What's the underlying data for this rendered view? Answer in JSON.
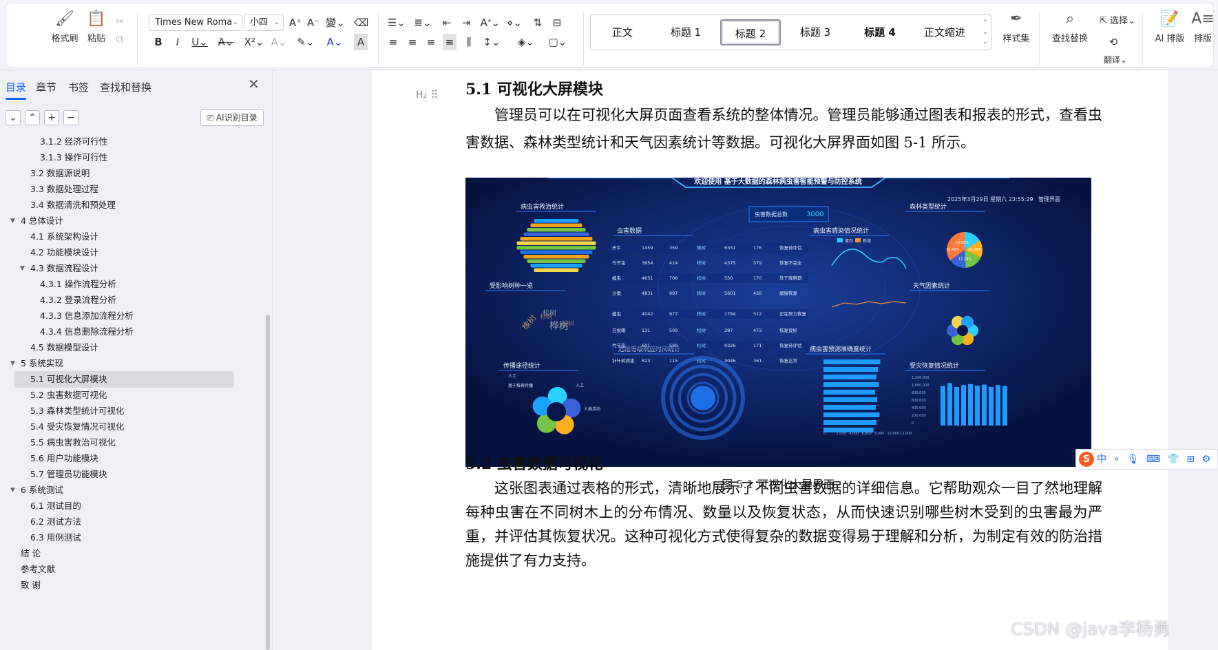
{
  "ribbon": {
    "format_painter": "格式刷",
    "paste": "粘贴",
    "font_family": "Times New Roma",
    "font_size": "小四",
    "styles": [
      {
        "label": "正文",
        "selected": false,
        "bold": false
      },
      {
        "label": "标题 1",
        "selected": false,
        "bold": false
      },
      {
        "label": "标题 2",
        "selected": true,
        "bold": false
      },
      {
        "label": "标题 3",
        "selected": false,
        "bold": false
      },
      {
        "label": "标题 4",
        "selected": false,
        "bold": true
      },
      {
        "label": "正文缩进",
        "selected": false,
        "bold": false
      }
    ],
    "style_set": "样式集",
    "find_replace": "查找替换",
    "select": "选择",
    "translate": "翻译",
    "ai_layout": "AI 排版",
    "layout": "排版"
  },
  "nav": {
    "tabs": [
      "目录",
      "章节",
      "书签",
      "查找和替换"
    ],
    "active_tab": "目录",
    "ai_toc": "AI识别目录",
    "items": [
      {
        "label": "3.1.2  经济可行性",
        "level": 3,
        "toggle": ""
      },
      {
        "label": "3.1.3  操作可行性",
        "level": 3,
        "toggle": ""
      },
      {
        "label": "3.2 数据源说明",
        "level": 2,
        "toggle": ""
      },
      {
        "label": "3.3 数据处理过程",
        "level": 2,
        "toggle": ""
      },
      {
        "label": "3.4 数据清洗和预处理",
        "level": 2,
        "toggle": ""
      },
      {
        "label": "4 总体设计",
        "level": 1,
        "toggle": "▼"
      },
      {
        "label": "4.1 系统架构设计",
        "level": 2,
        "toggle": ""
      },
      {
        "label": "4.2 功能模块设计",
        "level": 2,
        "toggle": ""
      },
      {
        "label": "4.3 数据流程设计",
        "level": 2,
        "toggle": "▼"
      },
      {
        "label": "4.3.1 操作流程分析",
        "level": 3,
        "toggle": ""
      },
      {
        "label": "4.3.2 登录流程分析",
        "level": 3,
        "toggle": ""
      },
      {
        "label": "4.3.3 信息添加流程分析",
        "level": 3,
        "toggle": ""
      },
      {
        "label": "4.3.4 信息删除流程分析",
        "level": 3,
        "toggle": ""
      },
      {
        "label": "4.5  数据模型设计",
        "level": 2,
        "toggle": ""
      },
      {
        "label": "5 系统实现",
        "level": 1,
        "toggle": "▼"
      },
      {
        "label": "5.1  可视化大屏模块",
        "level": 2,
        "toggle": "",
        "selected": true
      },
      {
        "label": "5.2  虫害数据可视化",
        "level": 2,
        "toggle": ""
      },
      {
        "label": "5.3  森林类型统计可视化",
        "level": 2,
        "toggle": ""
      },
      {
        "label": "5.4  受灾恢复情况可视化",
        "level": 2,
        "toggle": ""
      },
      {
        "label": "5.5  病虫害救治可视化",
        "level": 2,
        "toggle": ""
      },
      {
        "label": "5.6  用户功能模块",
        "level": 2,
        "toggle": ""
      },
      {
        "label": "5.7  管理员功能模块",
        "level": 2,
        "toggle": ""
      },
      {
        "label": "6 系统测试",
        "level": 1,
        "toggle": "▼"
      },
      {
        "label": "6.1  测试目的",
        "level": 2,
        "toggle": ""
      },
      {
        "label": "6.2  测试方法",
        "level": 2,
        "toggle": ""
      },
      {
        "label": "6.3  用例测试",
        "level": 2,
        "toggle": ""
      },
      {
        "label": "结    论",
        "level": 1,
        "toggle": ""
      },
      {
        "label": "参考文献",
        "level": 1,
        "toggle": ""
      },
      {
        "label": "致    谢",
        "level": 1,
        "toggle": ""
      }
    ]
  },
  "document": {
    "heading_mark": "H₂",
    "section1_title": "5.1  可视化大屏模块",
    "section1_para": "管理员可以在可视化大屏页面查看系统的整体情况。管理员能够通过图表和报表的形式，查看虫害数据、森林类型统计和天气因素统计等数据。可视化大屏界面如图 5-1 所示。",
    "figure_caption": "图 5.1  可视化大屏界面",
    "section2_title": "5.2  虫害数据可视化",
    "section2_para": "这张图表通过表格的形式，清晰地展示了不同虫害数据的详细信息。它帮助观众一目了然地理解每种虫害在不同树木上的分布情况、数量以及恢复状态，从而快速识别哪些树木受到的虫害最为严重，并评估其恢复状况。这种可视化方式使得复杂的数据变得易于理解和分析，为制定有效的防治措施提供了有力支持。"
  },
  "dashboard": {
    "title": "欢迎使用 基于大数据的森林病虫害智能预警与防控系统",
    "datetime": "2025年3月29日 星期六 23:55:29",
    "admin": "管理界面",
    "pest_total_label": "虫害数据总数",
    "pest_total_value": "3000",
    "panels": {
      "treatment": "病虫害救治统计",
      "pest_data": "虫害数据",
      "infection": "病虫害感染情况统计",
      "forest_type": "森林类型统计",
      "affected_species": "受影响树种一览",
      "weather": "天气因素统计",
      "spread": "传播途径统计",
      "danger": "危险等级响应时间统计",
      "prediction": "病虫害预测准确度统计",
      "recovery": "受灾恢复情况统计"
    },
    "word_cloud": [
      "橡树",
      "松树",
      "桦树",
      "杉树",
      "柏树"
    ],
    "spread_labels": [
      "人工",
      "人工",
      "基于报表传播",
      "人类活动"
    ],
    "table": [
      [
        "天牛",
        "1459",
        "359",
        "橡树",
        "6351",
        "176",
        "恢复待评估"
      ],
      [
        "竹节虫",
        "3654",
        "424",
        "桦树",
        "4375",
        "379",
        "恢复不完全"
      ],
      [
        "蝗虫",
        "4651",
        "708",
        "松树",
        "550",
        "170",
        "处于观察期"
      ],
      [
        "沙蚕",
        "4831",
        "997",
        "杨树",
        "5601",
        "428",
        "缓慢恢复"
      ],
      [
        "蝗虫",
        "4042",
        "977",
        "桦树",
        "1784",
        "512",
        "正在努力恢复"
      ],
      [
        "白蚁蛾",
        "131",
        "509",
        "松树",
        "287",
        "473",
        "恢复良好"
      ],
      [
        "竹节虫",
        "601",
        "599",
        "杉树",
        "9326",
        "171",
        "恢复待评估"
      ],
      [
        "针叶树病害",
        "823",
        "115",
        "松树",
        "3046",
        "361",
        "恢复正常"
      ]
    ],
    "infection_legend": [
      "蛋白",
      "新增"
    ],
    "pie_labels": [
      "16.09%",
      "16.43%",
      "16.09%",
      "17.23%"
    ],
    "recovery_y": [
      "1,200,000",
      "1,000,000",
      "800,000",
      "600,000",
      "400,000",
      "200,000",
      "0"
    ],
    "recovery_bars": [
      0.82,
      0.88,
      0.8,
      0.84,
      0.86,
      0.83,
      0.85,
      0.8,
      0.84,
      0.82
    ],
    "prediction_x": [
      "0",
      "2,000",
      "4,000",
      "6,000",
      "8,000",
      "10,000",
      "12,000"
    ],
    "prediction_bars": [
      0.75,
      0.72,
      0.7,
      0.73,
      0.68,
      0.71,
      0.69,
      0.74,
      0.7,
      0.66
    ]
  },
  "ime": {
    "logo": "S",
    "mode": "中",
    "tools": "∘ 🎙 ⌨ 👕 ⊞ ⚙"
  },
  "watermark": "CSDN @java李杨勇",
  "colors": {
    "accent": "#1f64f0",
    "dashboard_bg": "#08174a",
    "cyan": "#2ad1ff"
  }
}
